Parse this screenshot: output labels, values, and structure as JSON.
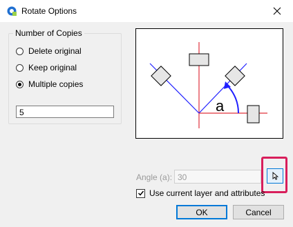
{
  "window": {
    "title": "Rotate Options"
  },
  "copies_group": {
    "legend": "Number of Copies",
    "options": [
      {
        "label": "Delete original",
        "selected": false
      },
      {
        "label": "Keep original",
        "selected": false
      },
      {
        "label": "Multiple copies",
        "selected": true
      }
    ],
    "count_value": "5"
  },
  "preview": {
    "angle_symbol": "a"
  },
  "angle": {
    "label": "Angle (a):",
    "value": "30",
    "enabled": false
  },
  "use_layer": {
    "label": "Use current layer and attributes",
    "checked": true
  },
  "buttons": {
    "ok": "OK",
    "cancel": "Cancel"
  },
  "colors": {
    "accent": "#0078d7",
    "highlight": "#d81e5b",
    "axis": "#e0303b",
    "rotation_line": "#1f1fff"
  },
  "icons": {
    "app": "app-logo-icon",
    "close": "close-icon",
    "pick": "cursor-arrow-icon",
    "check": "checkmark-icon"
  }
}
